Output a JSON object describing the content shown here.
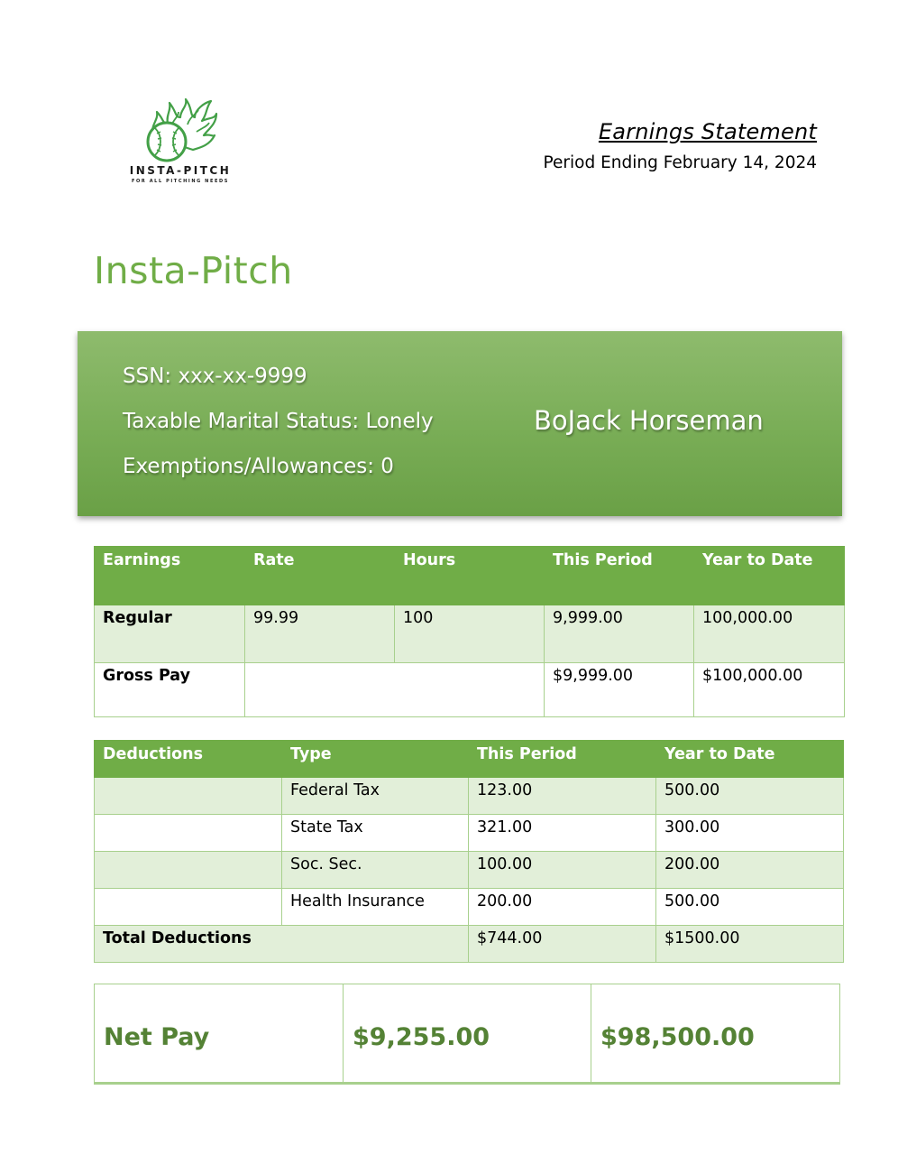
{
  "logo": {
    "name": "INSTA-PITCH",
    "tagline": "FOR ALL PITCHING NEEDS"
  },
  "header": {
    "title": "Earnings Statement",
    "period": "Period Ending February 14, 2024"
  },
  "company": "Insta-Pitch",
  "employee": {
    "ssn": "SSN: xxx-xx-9999",
    "marital_status": "Taxable Marital Status: Lonely",
    "exemptions": "Exemptions/Allowances: 0",
    "name": "BoJack Horseman"
  },
  "earnings": {
    "headers": [
      "Earnings",
      "Rate",
      "Hours",
      "This Period",
      "Year to Date"
    ],
    "regular": {
      "label": "Regular",
      "rate": "99.99",
      "hours": "100",
      "this_period": "9,999.00",
      "ytd": "100,000.00"
    },
    "gross": {
      "label": "Gross Pay",
      "this_period": "$9,999.00",
      "ytd": "$100,000.00"
    }
  },
  "deductions": {
    "headers": [
      "Deductions",
      "Type",
      "This Period",
      "Year to Date"
    ],
    "rows": [
      {
        "type": "Federal Tax",
        "this_period": "123.00",
        "ytd": "500.00"
      },
      {
        "type": "State Tax",
        "this_period": "321.00",
        "ytd": "300.00"
      },
      {
        "type": "Soc. Sec.",
        "this_period": "100.00",
        "ytd": "200.00"
      },
      {
        "type": "Health Insurance",
        "this_period": "200.00",
        "ytd": "500.00"
      }
    ],
    "total": {
      "label": "Total Deductions",
      "this_period": "$744.00",
      "ytd": "$1500.00"
    }
  },
  "net_pay": {
    "label": "Net Pay",
    "this_period": "$9,255.00",
    "ytd": "$98,500.00"
  },
  "colors": {
    "accent": "#70ad47",
    "light": "#e2efd9",
    "net_text": "#548235"
  }
}
